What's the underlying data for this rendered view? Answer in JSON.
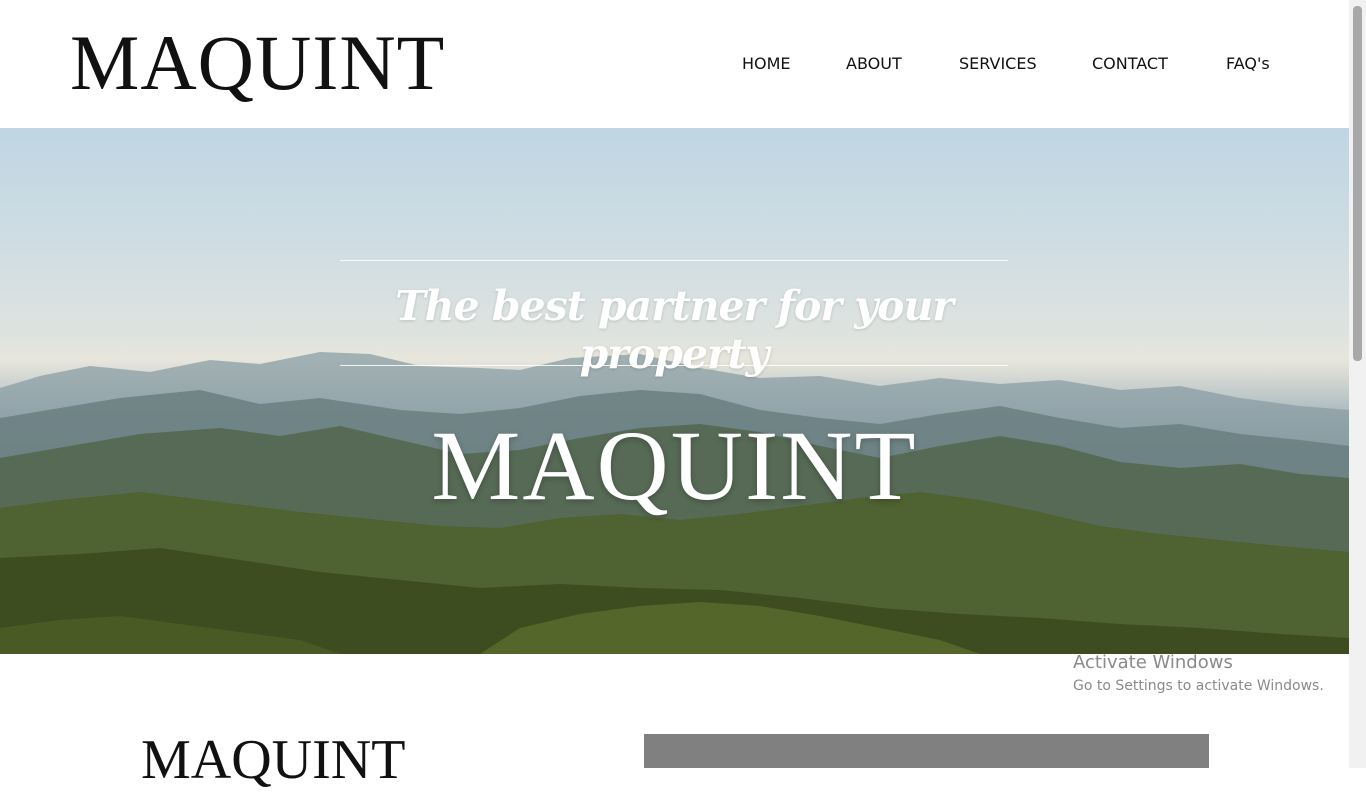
{
  "header": {
    "logo": "MAQUINT",
    "nav": [
      "HOME",
      "ABOUT",
      "SERVICES",
      "CONTACT",
      "FAQ's"
    ]
  },
  "hero": {
    "tagline": "The best partner for your property",
    "title": "MAQUINT"
  },
  "section": {
    "title": "MAQUINT"
  },
  "watermark": {
    "line1": "Activate Windows",
    "line2": "Go to Settings to activate Windows."
  },
  "colors": {
    "text": "#111111",
    "hero_text": "#ffffff",
    "watermark": "#8a8a8a",
    "gray_block": "#808080"
  }
}
